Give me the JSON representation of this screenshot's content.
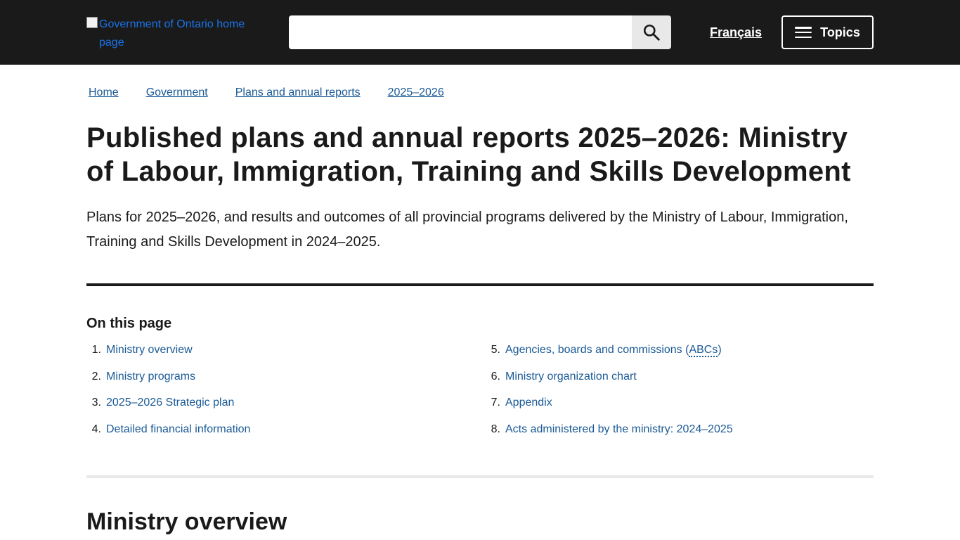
{
  "header": {
    "logo_alt": "Government of Ontario home page",
    "search": {
      "value": "",
      "placeholder": ""
    },
    "search_icon": "search-icon",
    "language_label": "Français",
    "topics_label": "Topics",
    "topics_icon": "menu-icon"
  },
  "breadcrumb": [
    {
      "label": "Home"
    },
    {
      "label": "Government"
    },
    {
      "label": "Plans and annual reports"
    },
    {
      "label": "2025–2026"
    }
  ],
  "page": {
    "title": "Published plans and annual reports 2025–2026: Ministry of Labour, Immigration, Training and Skills Development",
    "lead": "Plans for 2025–2026, and results and outcomes of all provincial programs delivered by the Ministry of Labour, Immigration, Training and Skills Development in 2024–2025."
  },
  "on_this_page": {
    "heading": "On this page",
    "items": [
      {
        "num": "1.",
        "label": "Ministry overview"
      },
      {
        "num": "2.",
        "label": "Ministry programs"
      },
      {
        "num": "3.",
        "label": "2025–2026 Strategic plan"
      },
      {
        "num": "4.",
        "label": "Detailed financial information"
      },
      {
        "num": "5.",
        "label_before": "Agencies, boards and commissions (",
        "abbr": "ABCs",
        "label_after": ")"
      },
      {
        "num": "6.",
        "label": "Ministry organization chart"
      },
      {
        "num": "7.",
        "label": "Appendix"
      },
      {
        "num": "8.",
        "label": "Acts administered by the ministry: 2024–2025"
      }
    ]
  },
  "section": {
    "title": "Ministry overview"
  },
  "colors": {
    "header_bg": "#1a1a1a",
    "link": "#1a5a96",
    "text": "#1a1a1a",
    "divider_light": "#e8e8e8"
  }
}
